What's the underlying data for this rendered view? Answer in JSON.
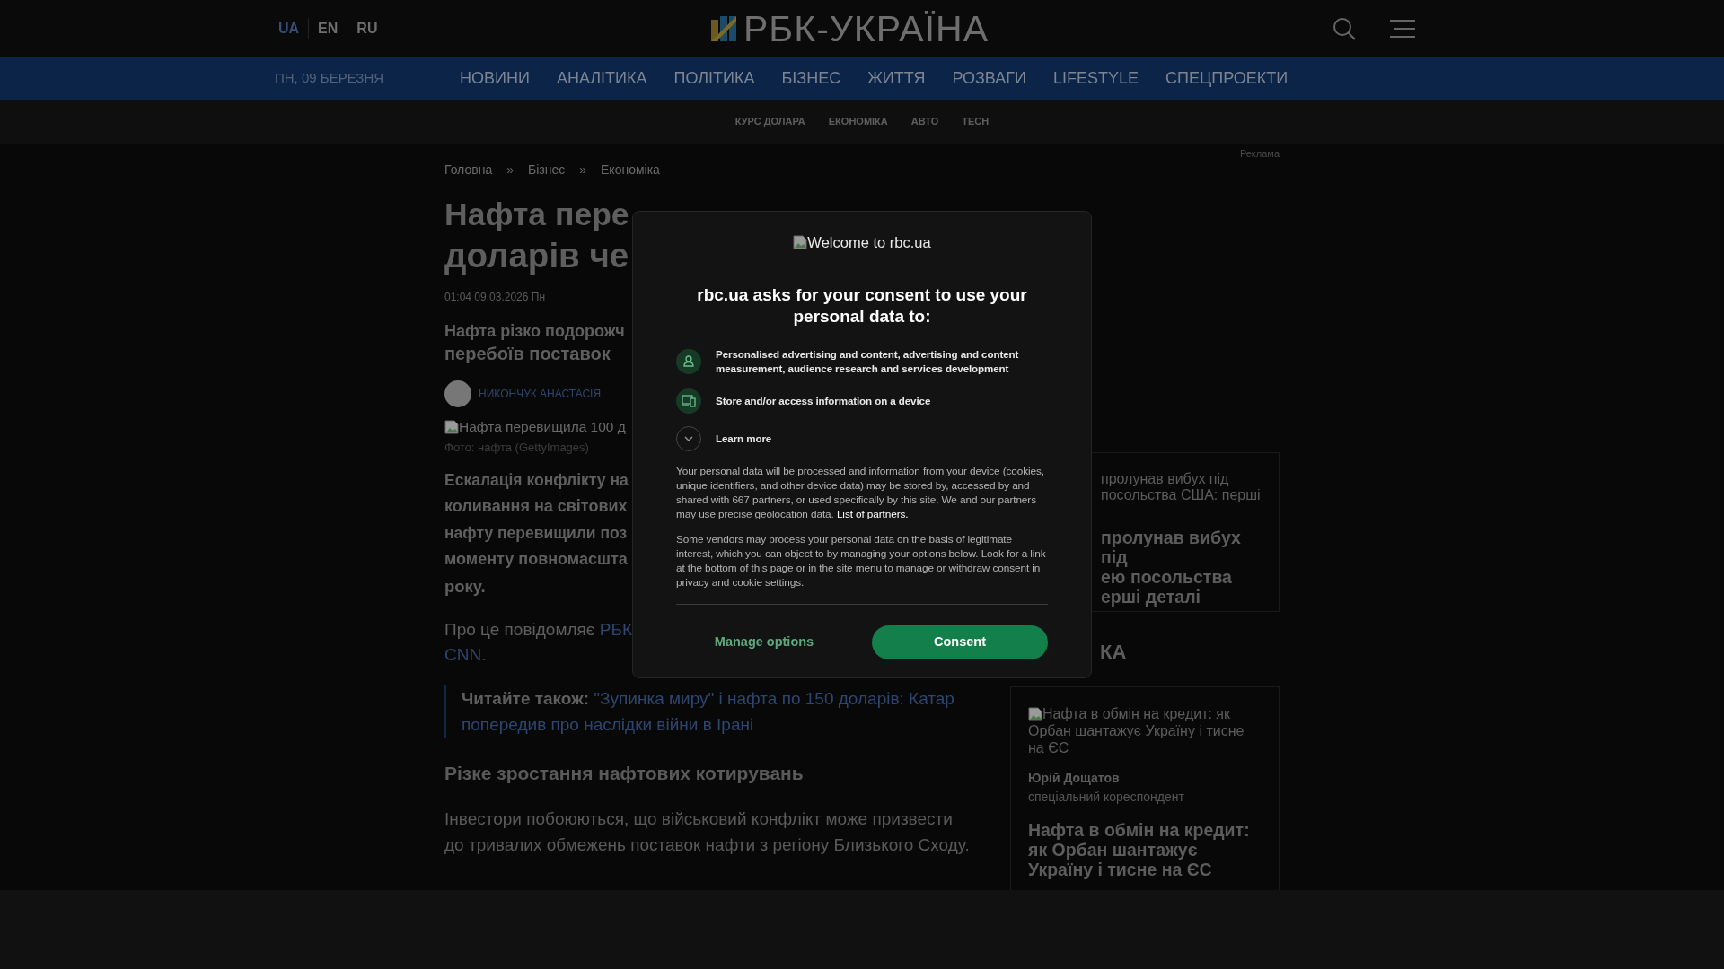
{
  "header": {
    "languages": [
      {
        "label": "UA",
        "selected": true
      },
      {
        "label": "EN",
        "selected": false
      },
      {
        "label": "RU",
        "selected": false
      }
    ],
    "logo": "РБК-УКРАЇНА"
  },
  "nav": {
    "date": "ПН, 09 БЕРЕЗНЯ",
    "items": [
      "НОВИНИ",
      "АНАЛІТИКА",
      "ПОЛІТИКА",
      "БІЗНЕС",
      "ЖИТТЯ",
      "РОЗВАГИ",
      "LIFESTYLE",
      "СПЕЦПРОЕКТИ"
    ]
  },
  "subnav": [
    "КУРС ДОЛАРА",
    "ЕКОНОМІКА",
    "АВТО",
    "TECH"
  ],
  "breadcrumbs": {
    "separator": "»",
    "items": [
      "Головна",
      "Бізнес",
      "Економіка"
    ]
  },
  "article": {
    "headline_lines": [
      "Нафта пере",
      "доларів че"
    ],
    "date": "01:04 09.03.2026 Пн",
    "lead_lines": [
      "Нафта різко подорожч",
      "перебоїв поставок"
    ],
    "author": "НИКОНЧУК АНАСТАСІЯ",
    "image_alt": "Нафта перевищила 100 д",
    "caption": "Фото: нафта (GettyImages)",
    "intro_lines": [
      "Ескалація конфлікту на",
      "коливання на світових",
      "нафту перевищили поз",
      "моменту повномасшта",
      "року."
    ],
    "source": {
      "prefix": "Про це повідомляє",
      "links": [
        "РБК",
        "CNN."
      ]
    },
    "read_also": {
      "label": "Читайте також:",
      "link": "\"Зупинка миру\" і нафта по 150 доларів: Катар попередив про наслідки війни в Ірані"
    },
    "subheading": "Різке зростання нафтових котирувань",
    "paragraph": "Інвестори побоюються, що військовий конфлікт може призвести до тривалих обмежень поставок нафти з регіону Близького Сходу."
  },
  "sidebar": {
    "ad_label": "Реклама",
    "news_card": {
      "image_alt_lines": [
        "пролунав вибух під",
        "посольства США: перші"
      ],
      "title_lines": [
        "пролунав вибух під",
        "ею посольства",
        "ерші деталі"
      ]
    },
    "section_title": "КА",
    "analytics_card": {
      "image_alt": "Нафта в обмін на кредит: як Орбан шантажує Україну і тисне на ЄС",
      "author": "Юрій Дощатов",
      "role": "спеціальний кореспондент",
      "title": "Нафта в обмін на кредит: як Орбан шантажує Україну і тисне на ЄС"
    }
  },
  "consent": {
    "logo_alt": "Welcome to rbc.ua",
    "heading": "rbc.ua asks for your consent to use your personal data to:",
    "purposes": [
      {
        "kind": "person",
        "text": "Personalised advertising and content, advertising and content measurement, audience research and services development"
      },
      {
        "kind": "device",
        "text": "Store and/or access information on a device"
      },
      {
        "kind": "expand",
        "text": "Learn more"
      }
    ],
    "paragraph_1": "Your personal data will be processed and information from your device (cookies, unique identifiers, and other device data) may be stored by, accessed by and shared with 667 partners, or used specifically by this site. We and our partners may use precise geolocation data.",
    "partners_link": "List of partners.",
    "paragraph_2": "Some vendors may process your personal data on the basis of legitimate interest, which you can object to by managing your options below. Look for a link at the bottom of this page or in the site menu to manage or withdraw consent in privacy and cookie settings.",
    "buttons": {
      "manage": "Manage options",
      "consent": "Consent"
    }
  }
}
